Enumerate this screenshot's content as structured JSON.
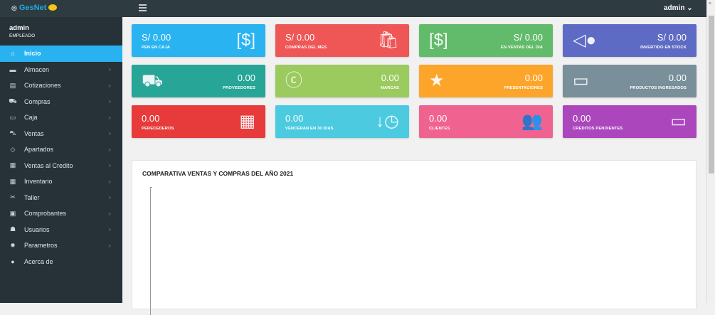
{
  "topbar": {
    "brand": "GesNet",
    "user_menu": "admin ⌄"
  },
  "sidebar": {
    "user": "admin",
    "role": "EMPLEADO",
    "items": [
      {
        "label": "Inicio",
        "icon": "home-icon",
        "glyph": "⌂",
        "active": true,
        "sub": false
      },
      {
        "label": "Almacen",
        "icon": "archive-icon",
        "glyph": "▬",
        "sub": true
      },
      {
        "label": "Cotizaciones",
        "icon": "document-icon",
        "glyph": "▤",
        "sub": true
      },
      {
        "label": "Compras",
        "icon": "truck-icon",
        "glyph": "⛟",
        "sub": true
      },
      {
        "label": "Caja",
        "icon": "money-icon",
        "glyph": "▭",
        "sub": true
      },
      {
        "label": "Ventas",
        "icon": "cart-icon",
        "glyph": "⛍",
        "sub": true
      },
      {
        "label": "Apartados",
        "icon": "tags-icon",
        "glyph": "◇",
        "sub": true
      },
      {
        "label": "Ventas al Credito",
        "icon": "credit-icon",
        "glyph": "▦",
        "sub": true
      },
      {
        "label": "Inventario",
        "icon": "grid-icon",
        "glyph": "▦",
        "sub": true
      },
      {
        "label": "Taller",
        "icon": "tools-icon",
        "glyph": "✂",
        "sub": true
      },
      {
        "label": "Comprobantes",
        "icon": "receipt-icon",
        "glyph": "▣",
        "sub": true
      },
      {
        "label": "Usuarios",
        "icon": "users-icon",
        "glyph": "☗",
        "sub": true
      },
      {
        "label": "Parametros",
        "icon": "gear-icon",
        "glyph": "✹",
        "sub": true
      },
      {
        "label": "Acerca de",
        "icon": "info-icon",
        "glyph": "●",
        "sub": false
      }
    ]
  },
  "cards": [
    {
      "value": "S/ 0.00",
      "label": "PEN EN CAJA",
      "color": "#2ab3f1",
      "icon": "money-icon",
      "glyph": "[$]",
      "align": "L"
    },
    {
      "value": "S/ 0.00",
      "label": "COMPRAS DEL MES",
      "color": "#ef5656",
      "icon": "shopping-bag-icon",
      "glyph": "🛍",
      "align": "L"
    },
    {
      "value": "S/ 0.00",
      "label": "EN VENTAS DEL DIA",
      "color": "#62bb6a",
      "icon": "cash-stack-icon",
      "glyph": "[$]",
      "align": "R"
    },
    {
      "value": "S/ 0.00",
      "label": "INVERTIDO EN STOCK",
      "color": "#5e6bc4",
      "icon": "tag-icon",
      "glyph": "◁●",
      "align": "R"
    },
    {
      "value": "0.00",
      "label": "PROVEEDORES",
      "color": "#27a596",
      "icon": "truck-icon",
      "glyph": "⛟",
      "align": "R"
    },
    {
      "value": "0.00",
      "label": "MARCAS",
      "color": "#9bca5f",
      "icon": "creative-commons-icon",
      "glyph": "ⓒ",
      "align": "R"
    },
    {
      "value": "0.00",
      "label": "PRESENTACIONES",
      "color": "#fda52a",
      "icon": "pictures-icon",
      "glyph": "★",
      "align": "R"
    },
    {
      "value": "0.00",
      "label": "PRODUCTOS INGRESADOS",
      "color": "#798f9a",
      "icon": "box-icon",
      "glyph": "▭",
      "align": "R"
    },
    {
      "value": "0.00",
      "label": "PERECEDEROS",
      "color": "#e73a3a",
      "icon": "calendar-icon",
      "glyph": "▦",
      "align": "L"
    },
    {
      "value": "0.00",
      "label": "VENCERAN EN 30 DIAS",
      "color": "#4ccbe0",
      "icon": "history-icon",
      "glyph": "↓◷",
      "align": "L"
    },
    {
      "value": "0.00",
      "label": "CLIENTES",
      "color": "#f0628f",
      "icon": "users-icon",
      "glyph": "👥",
      "align": "L"
    },
    {
      "value": "0.00",
      "label": "CREDITOS PENDIENTES",
      "color": "#ab46bd",
      "icon": "wallet-icon",
      "glyph": "▭",
      "align": "L"
    }
  ],
  "panel": {
    "title": "COMPARATIVA VENTAS Y COMPRAS DEL AÑO 2021"
  }
}
